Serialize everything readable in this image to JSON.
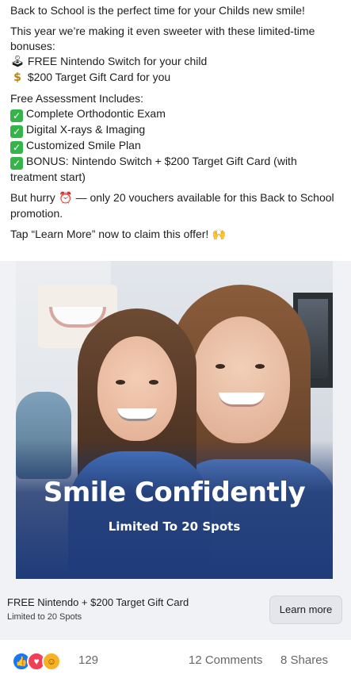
{
  "post": {
    "intro": "Back to School is the perfect time for your Childs new smile!",
    "sweeter": "This year we’re making it even sweeter with these limited-time bonuses:",
    "bonuses": [
      {
        "icon": "joystick-icon",
        "glyph": "🕹",
        "text": "FREE Nintendo Switch for your child"
      },
      {
        "icon": "money-bag-icon",
        "glyph": "$",
        "text": "$200 Target Gift Card for you"
      }
    ],
    "assessment_heading": "Free Assessment Includes:",
    "assessment_items": [
      "Complete Orthodontic Exam",
      "Digital X-rays & Imaging",
      "Customized Smile Plan",
      "BONUS: Nintendo Switch + $200 Target Gift Card (with treatment start)"
    ],
    "hurry_before": "But hurry",
    "hurry_after": "— only 20 vouchers available for this Back to School promotion.",
    "tap_text": "Tap “Learn More” now to claim this offer!",
    "tap_glyph": "🙌"
  },
  "ad": {
    "headline": "Smile Confidently",
    "subhead": "Limited To 20 Spots"
  },
  "cta": {
    "title": "FREE Nintendo + $200 Target Gift Card",
    "subtitle": "Limited to 20 Spots",
    "button_label": "Learn more"
  },
  "engagement": {
    "reactions": [
      "like-icon",
      "love-icon",
      "care-icon"
    ],
    "reaction_count": "129",
    "comments": "12 Comments",
    "shares": "8 Shares"
  },
  "colors": {
    "check_green": "#35b44a",
    "like_blue": "#1877f2",
    "love_red": "#f33e58",
    "overlay_blue": "#1f3b7a"
  }
}
